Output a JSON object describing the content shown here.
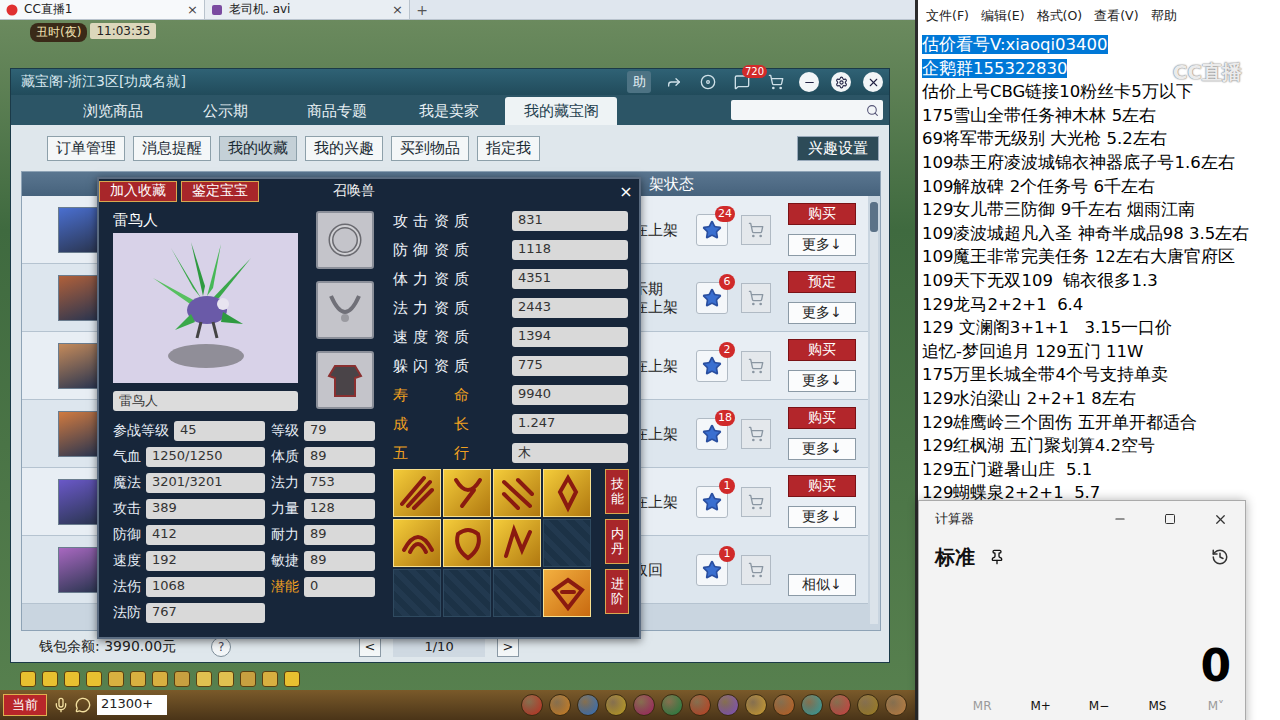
{
  "browser": {
    "tabs": [
      {
        "label": "CC直播1",
        "selected": true
      },
      {
        "label": "老司机. avi",
        "selected": false
      }
    ],
    "close": "×",
    "new_tab": "+"
  },
  "game": {
    "time_period": "丑时(夜)",
    "clock": "11:03:35",
    "chat_channel": "当前",
    "chat_input": "21300+"
  },
  "cbg": {
    "title": "藏宝阁-浙江3区[功成名就]",
    "help_button": "助",
    "message_count": "720",
    "tabs": [
      {
        "label": "浏览商品",
        "selected": false
      },
      {
        "label": "公示期",
        "selected": false
      },
      {
        "label": "商品专题",
        "selected": false
      },
      {
        "label": "我是卖家",
        "selected": false
      },
      {
        "label": "我的藏宝阁",
        "selected": true
      }
    ],
    "sub_tabs": [
      {
        "label": "订单管理",
        "selected": false
      },
      {
        "label": "消息提醒",
        "selected": false
      },
      {
        "label": "我的收藏",
        "selected": true
      },
      {
        "label": "我的兴趣",
        "selected": false
      },
      {
        "label": "买到物品",
        "selected": false
      },
      {
        "label": "指定我",
        "selected": false
      }
    ],
    "interest_settings": "兴趣设置",
    "column_header": "架状态",
    "rows": [
      {
        "status": [
          "在上架"
        ],
        "favorites": "24",
        "action": "购买",
        "more": "更多↓"
      },
      {
        "status": [
          "示期",
          "在上架"
        ],
        "favorites": "6",
        "action": "预定",
        "more": "更多↓"
      },
      {
        "status": [
          "在上架"
        ],
        "favorites": "2",
        "action": "购买",
        "more": "更多↓"
      },
      {
        "status": [
          "在上架"
        ],
        "favorites": "18",
        "action": "购买",
        "more": "更多↓"
      },
      {
        "status": [
          "在上架"
        ],
        "favorites": "1",
        "action": "购买",
        "more": "更多↓"
      },
      {
        "status": [
          "取回"
        ],
        "favorites": "1",
        "action": null,
        "more": "相似↓"
      }
    ],
    "wallet": "钱包余额: 3990.00元",
    "help": "?",
    "pager": {
      "prev": "<",
      "page": "1/10",
      "next": ">"
    }
  },
  "pet_dialog": {
    "actions": [
      "加入收藏",
      "鉴定宝宝"
    ],
    "title": "召唤兽",
    "close": "×",
    "pet_name": "雷鸟人",
    "name_field": "雷鸟人",
    "base_stats": [
      [
        {
          "label": "参战等级",
          "value": "45",
          "highlight": false
        },
        {
          "label": "等级",
          "value": "79",
          "highlight": false
        }
      ],
      [
        {
          "label": "气血",
          "value": "1250/1250",
          "highlight": false
        },
        {
          "label": "体质",
          "value": "89",
          "highlight": false
        }
      ],
      [
        {
          "label": "魔法",
          "value": "3201/3201",
          "highlight": false
        },
        {
          "label": "法力",
          "value": "753",
          "highlight": false
        }
      ],
      [
        {
          "label": "攻击",
          "value": "389",
          "highlight": false
        },
        {
          "label": "力量",
          "value": "128",
          "highlight": false
        }
      ],
      [
        {
          "label": "防御",
          "value": "412",
          "highlight": false
        },
        {
          "label": "耐力",
          "value": "89",
          "highlight": false
        }
      ],
      [
        {
          "label": "速度",
          "value": "192",
          "highlight": false
        },
        {
          "label": "敏捷",
          "value": "89",
          "highlight": false
        }
      ],
      [
        {
          "label": "法伤",
          "value": "1068",
          "highlight": false
        },
        {
          "label": "潜能",
          "value": "0",
          "highlight": true
        }
      ],
      [
        {
          "label": "法防",
          "value": "767",
          "highlight": false
        }
      ]
    ],
    "aptitudes": [
      {
        "label": "攻击资质",
        "value": "831",
        "highlight": false
      },
      {
        "label": "防御资质",
        "value": "1118",
        "highlight": false
      },
      {
        "label": "体力资质",
        "value": "4351",
        "highlight": false
      },
      {
        "label": "法力资质",
        "value": "2443",
        "highlight": false
      },
      {
        "label": "速度资质",
        "value": "1394",
        "highlight": false
      },
      {
        "label": "躲闪资质",
        "value": "775",
        "highlight": false
      },
      {
        "label": "寿命",
        "value": "9940",
        "highlight": true
      },
      {
        "label": "成长",
        "value": "1.247",
        "highlight": true
      },
      {
        "label": "五行",
        "value": "木",
        "highlight": true
      }
    ],
    "skills": [
      {
        "filled": true
      },
      {
        "filled": true
      },
      {
        "filled": true
      },
      {
        "filled": true
      },
      {
        "filled": true
      },
      {
        "filled": true
      },
      {
        "filled": true
      },
      {
        "filled": false
      },
      {
        "filled": false
      },
      {
        "filled": false
      },
      {
        "filled": false
      },
      {
        "filled": true
      }
    ],
    "side_buttons": [
      "技能",
      "内丹",
      "进阶"
    ]
  },
  "notepad": {
    "menu": [
      "文件(F)",
      "编辑(E)",
      "格式(O)",
      "查看(V)",
      "帮助"
    ],
    "watermark": "CC直播",
    "lines": [
      {
        "text": "估价看号V:xiaoqi03400",
        "selected": true
      },
      {
        "text": "企鹅群155322830",
        "selected": true
      },
      {
        "text": "估价上号CBG链接10粉丝卡5万以下",
        "selected": false
      },
      {
        "text": "175雪山全带任务神木林 5左右",
        "selected": false
      },
      {
        "text": "69将军带无级别 大光枪 5.2左右",
        "selected": false
      },
      {
        "text": "109恭王府凌波城锦衣神器底子号1.6左右",
        "selected": false
      },
      {
        "text": "109解放碑 2个任务号 6千左右",
        "selected": false
      },
      {
        "text": "129女儿带三防御 9千左右 烟雨江南",
        "selected": false
      },
      {
        "text": "109凌波城超凡入圣 神奇半成品98 3.5左右",
        "selected": false
      },
      {
        "text": "109魔王非常完美任务 12左右大唐官府区",
        "selected": false
      },
      {
        "text": "109天下无双109  锦衣很多1.3",
        "selected": false
      },
      {
        "text": "129龙马2+2+1  6.4",
        "selected": false
      },
      {
        "text": "129 文澜阁3+1+1   3.15一口价",
        "selected": false
      },
      {
        "text": "追忆-梦回追月 129五门 11W",
        "selected": false
      },
      {
        "text": "175万里长城全带4个号支持单卖",
        "selected": false
      },
      {
        "text": "129水泊梁山 2+2+1 8左右",
        "selected": false
      },
      {
        "text": "129雄鹰岭三个固伤 五开单开都适合",
        "selected": false
      },
      {
        "text": "129红枫湖 五门聚划算4.2空号",
        "selected": false
      },
      {
        "text": "129五门避暑山庄  5.1",
        "selected": false
      },
      {
        "text": "129蝴蝶泉2+2+1  5.7",
        "selected": false
      }
    ]
  },
  "calculator": {
    "title": "计算器",
    "mode": "标准",
    "display": "0",
    "memory": [
      {
        "label": "MR",
        "disabled": true
      },
      {
        "label": "M+",
        "disabled": false
      },
      {
        "label": "M−",
        "disabled": false
      },
      {
        "label": "MS",
        "disabled": false
      },
      {
        "label": "M˅",
        "disabled": true
      }
    ]
  }
}
